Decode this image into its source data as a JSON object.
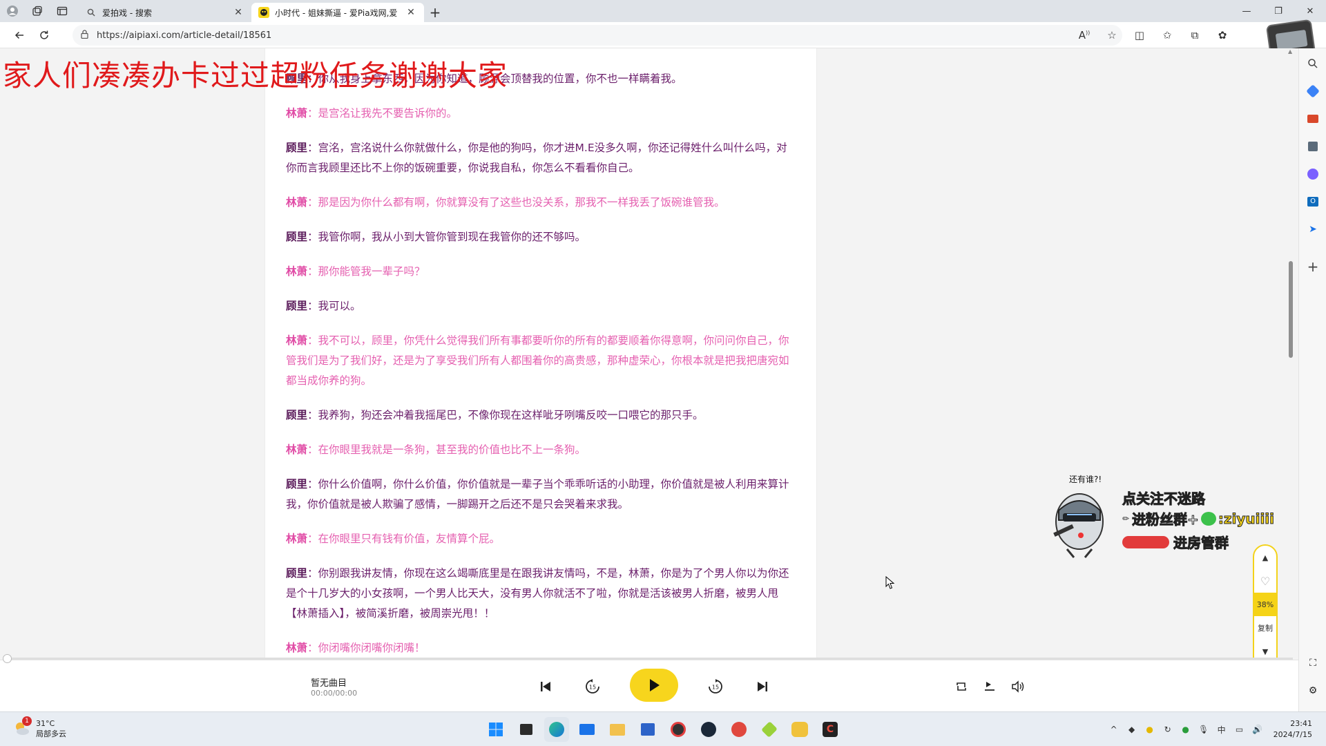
{
  "tabs": [
    {
      "title": "爱拍戏 - 搜索",
      "active": false
    },
    {
      "title": "小时代 - 姐妹撕逼 - 爱Pia戏网,爱",
      "active": true
    }
  ],
  "address": {
    "url": "https://aipiaxi.com/article-detail/18561"
  },
  "overlay_text": "家人们凑凑办卡过过超粉任务谢谢大家",
  "script_lines": [
    {
      "speaker": "顾里",
      "sep": "：",
      "text": "你从我身上拿东西，因为你知道，顾源会顶替我的位置，你不也一样瞒着我。",
      "role": "gu"
    },
    {
      "speaker": "林萧",
      "sep": "：",
      "text": "是宫洺让我先不要告诉你的。",
      "role": "lin"
    },
    {
      "speaker": "顾里",
      "sep": "：",
      "text": "宫洺，宫洺说什么你就做什么，你是他的狗吗，你才进M.E没多久啊，你还记得姓什么叫什么吗，对你而言我顾里还比不上你的饭碗重要，你说我自私，你怎么不看看你自己。",
      "role": "gu"
    },
    {
      "speaker": "林萧",
      "sep": "：",
      "text": "那是因为你什么都有啊，你就算没有了这些也没关系，那我不一样我丢了饭碗谁管我。",
      "role": "lin"
    },
    {
      "speaker": "顾里",
      "sep": "：",
      "text": "我管你啊，我从小到大管你管到现在我管你的还不够吗。",
      "role": "gu"
    },
    {
      "speaker": "林萧",
      "sep": "：",
      "text": "那你能管我一辈子吗？",
      "role": "lin"
    },
    {
      "speaker": "顾里",
      "sep": "：",
      "text": "我可以。",
      "role": "gu"
    },
    {
      "speaker": "林萧",
      "sep": "：",
      "text": "我不可以，顾里，你凭什么觉得我们所有事都要听你的所有的都要顺着你得意啊，你问问你自己，你管我们是为了我们好，还是为了享受我们所有人都围着你的高贵感，那种虚荣心，你根本就是把我把唐宛如都当成你养的狗。",
      "role": "lin"
    },
    {
      "speaker": "顾里",
      "sep": "：",
      "text": "我养狗，狗还会冲着我摇尾巴，不像你现在这样呲牙咧嘴反咬一口喂它的那只手。",
      "role": "gu"
    },
    {
      "speaker": "林萧",
      "sep": "：",
      "text": "在你眼里我就是一条狗，甚至我的价值也比不上一条狗。",
      "role": "lin"
    },
    {
      "speaker": "顾里",
      "sep": "：",
      "text": "你什么价值啊，你什么价值，你价值就是一辈子当个乖乖听话的小助理，你价值就是被人利用来算计我，你价值就是被人欺骗了感情，一脚踢开之后还不是只会哭着来求我。",
      "role": "gu"
    },
    {
      "speaker": "林萧",
      "sep": "：",
      "text": "在你眼里只有钱有价值，友情算个屁。",
      "role": "lin"
    },
    {
      "speaker": "顾里",
      "sep": "：",
      "text": "你别跟我讲友情，你现在这么竭嘶底里是在跟我讲友情吗，不是，林萧，你是为了个男人你以为你还是个十几岁大的小女孩啊，一个男人比天大，没有男人你就活不了啦，你就是活该被男人折磨，被男人甩【林萧插入】，被简溪折磨，被周崇光甩！！",
      "role": "gu"
    },
    {
      "speaker": "林萧",
      "sep": "：",
      "text": "你闭嘴你闭嘴你闭嘴！",
      "role": "lin"
    }
  ],
  "float_widget": {
    "progress_percent": 38,
    "progress_label": "38%",
    "copy_label": "复制"
  },
  "player": {
    "title": "暂无曲目",
    "time": "00:00/00:00"
  },
  "sticker": {
    "top_text": "还有谁?!",
    "line1": "点关注不迷路",
    "line2": "进粉丝群+",
    "line2b": ":ziyuiiii",
    "line3": "进房管群"
  },
  "taskbar": {
    "temperature": "31°C",
    "weather": "局部多云",
    "notif_badge": "1",
    "ime": "中",
    "time": "23:41",
    "date": "2024/7/15"
  },
  "colors": {
    "speaker_gu": "#5a1a5a",
    "speaker_lin": "#e04aa5",
    "overlay": "#e0191b",
    "accent": "#f7d51d"
  }
}
